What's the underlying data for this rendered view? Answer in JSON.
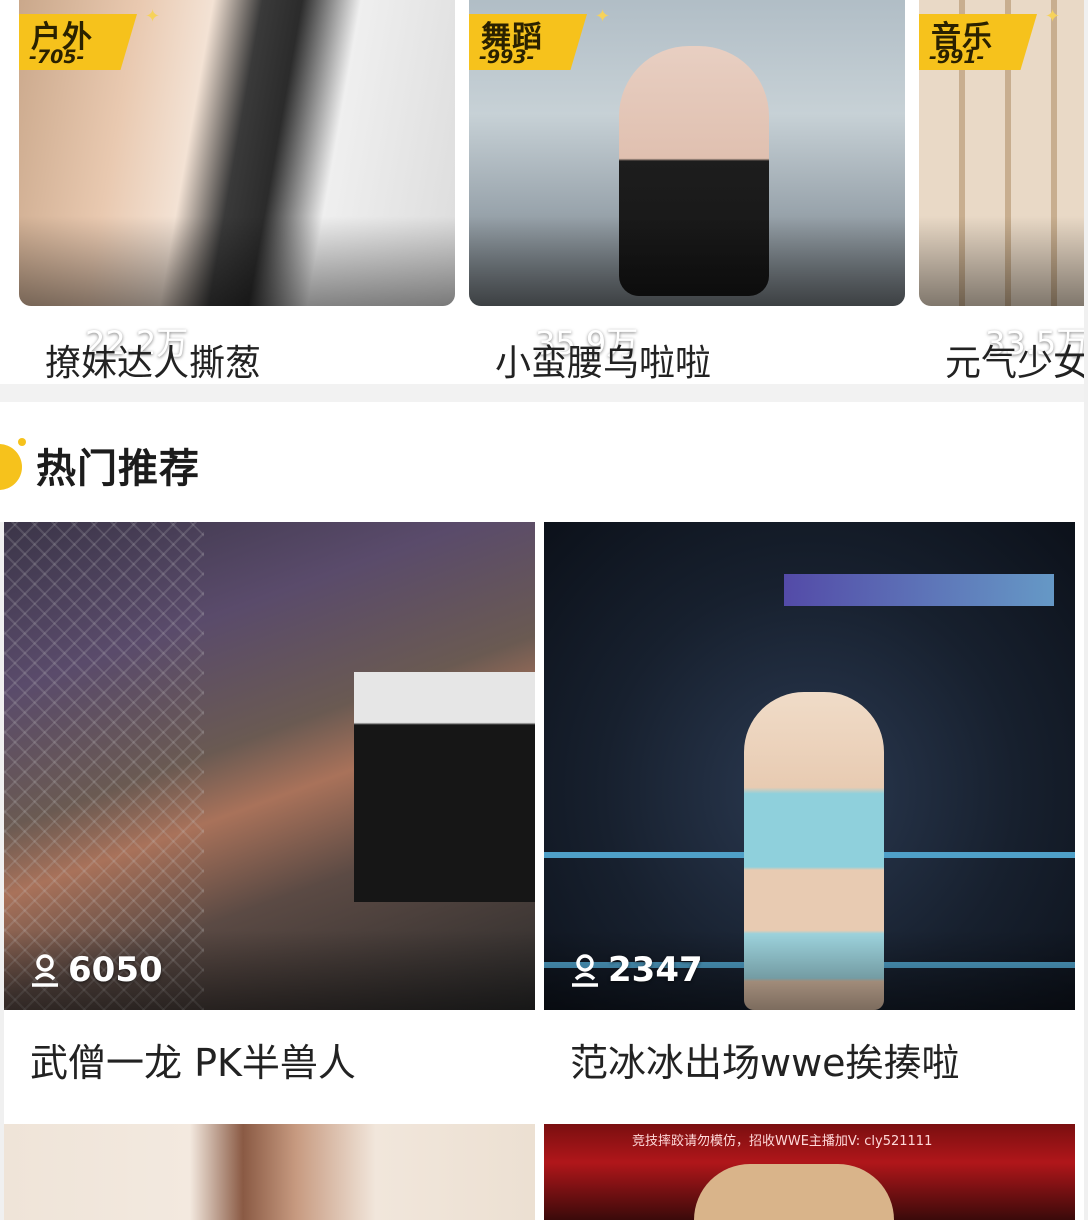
{
  "carousel": {
    "cards": [
      {
        "category": "户外",
        "category_count": "-705-",
        "viewers": "22.2万",
        "title": "撩妹达人撕葱"
      },
      {
        "category": "舞蹈",
        "category_count": "-993-",
        "viewers": "35.9万",
        "title": "小蛮腰乌啦啦"
      },
      {
        "category": "音乐",
        "category_count": "-991-",
        "viewers": "33.5万",
        "title": "元气少女"
      }
    ]
  },
  "section": {
    "title": "热门推荐"
  },
  "recommended": [
    {
      "viewers": "6050",
      "title": "武僧一龙 PK半兽人"
    },
    {
      "viewers": "2347",
      "title": "范冰冰出场wwe挨揍啦"
    },
    {
      "viewers": "",
      "title": ""
    },
    {
      "viewers": "",
      "title": "",
      "banner_text": "竞技摔跤请勿模仿，招收WWE主播加V: cly521111"
    }
  ],
  "colors": {
    "accent": "#f6c21c",
    "divider": "#f2f2f2"
  },
  "icons": {
    "viewer": "user-icon",
    "sparkle": "sparkle-icon"
  }
}
